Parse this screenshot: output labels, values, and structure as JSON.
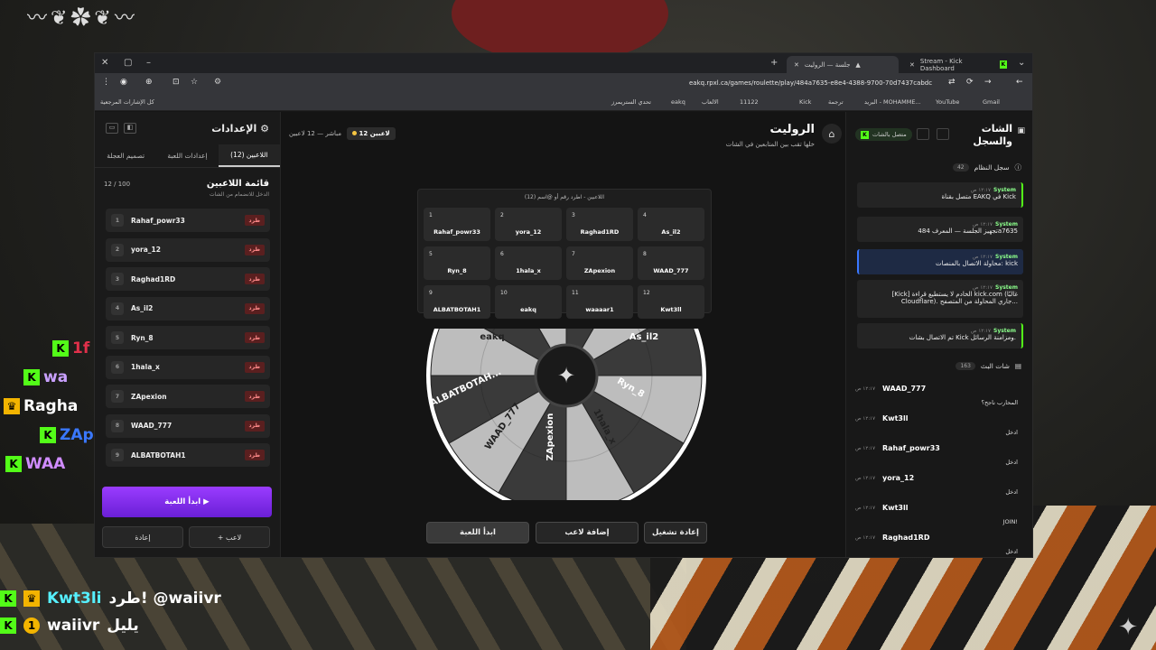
{
  "browser": {
    "tabs": [
      {
        "label": "جلسة — الروليت"
      },
      {
        "label": "Stream - Kick Dashboard"
      }
    ],
    "url": "eakq.rpxl.ca/games/roulette/play/484a7635-e8e4-4388-9700-70d7437cabdc",
    "bookmarks": [
      "Gmail",
      "YouTube",
      "البريد - MOHAMME...",
      "ترجمة",
      "Kick",
      "11122",
      "الالعاب",
      "eakq",
      "تحدي الستريمرز",
      "كل الإشارات المرجعية"
    ]
  },
  "settings": {
    "title": "الإعدادات",
    "tabs": [
      "اللاعبين (12)",
      "إعدادات اللعبة",
      "تصميم العجلة"
    ],
    "players_title": "قائمة اللاعبين",
    "players_sub": "الدخل للانضمام من الشات",
    "count": "12 / 100",
    "kick_label": "طرد",
    "players": [
      {
        "n": "1",
        "name": "Rahaf_powr33"
      },
      {
        "n": "2",
        "name": "yora_12"
      },
      {
        "n": "3",
        "name": "Raghad1RD"
      },
      {
        "n": "4",
        "name": "As_il2"
      },
      {
        "n": "5",
        "name": "Ryn_8"
      },
      {
        "n": "6",
        "name": "1hala_x"
      },
      {
        "n": "7",
        "name": "ZApexion"
      },
      {
        "n": "8",
        "name": "WAAD_777"
      },
      {
        "n": "9",
        "name": "ALBATBOTAH1"
      }
    ],
    "start_label": "ابدأ اللعبة ▶",
    "reset_label": "إعادة",
    "add_label": "+ لاعب"
  },
  "center": {
    "title": "الروليت",
    "subtitle": "خلها تقب بين المتابعين في الشات",
    "live_count": "12 لاعبين",
    "live_text": "مباشر — 12 لاعبين",
    "grid_caption": "اللاعبين - اطرد رقم أو @اسم (12)",
    "grid": [
      {
        "n": "1",
        "name": "Rahaf_powr33"
      },
      {
        "n": "2",
        "name": "yora_12"
      },
      {
        "n": "3",
        "name": "Raghad1RD"
      },
      {
        "n": "4",
        "name": "As_il2"
      },
      {
        "n": "5",
        "name": "Ryn_8"
      },
      {
        "n": "6",
        "name": "1hala_x"
      },
      {
        "n": "7",
        "name": "ZApexion"
      },
      {
        "n": "8",
        "name": "WAAD_777"
      },
      {
        "n": "9",
        "name": "ALBATBOTAH1"
      },
      {
        "n": "10",
        "name": "eakq"
      },
      {
        "n": "11",
        "name": "waaaar1"
      },
      {
        "n": "12",
        "name": "Kwt3ll"
      }
    ],
    "wheel_labels": [
      "eakq",
      "As_il2",
      "ALBATBOTAH...",
      "Ryn_8",
      "WAAD_777",
      "1hala_x",
      "ZApexion"
    ],
    "btn_start": "ابدأ اللعبة",
    "btn_add": "إضافة لاعب",
    "btn_restart": "إعادة تشغيل"
  },
  "chat": {
    "title": "الشات والسجل",
    "connected": "متصل بالشات",
    "system_log_title": "سجل النظام",
    "system_log_count": "42",
    "system_messages": [
      {
        "who": "System",
        "time": "١٢:١٧ ص",
        "text": "متصل بقناة EAKQ في Kick"
      },
      {
        "who": "System",
        "time": "١٢:١٧ ص",
        "text": "تجهيز الجلسة — المعرف 484a7635"
      },
      {
        "who": "System",
        "time": "١٢:١٧ ص",
        "text": "محاولة الاتصال بالمنصات: kick"
      },
      {
        "who": "System",
        "time": "١٢:١٧ ص",
        "text": "[Kick] الخادم لا يستطيع قراءة kick.com (غالبًا Cloudflare). جاري المحاولة من المتصفح..."
      },
      {
        "who": "System",
        "time": "١٢:١٧ ص",
        "text": "تم الاتصال بشات Kick ومزامنة الرسائل."
      }
    ],
    "live_chat_title": "شات البث",
    "live_chat_count": "163",
    "messages": [
      {
        "user": "WAAD_777",
        "time": "١٢:١٧ ص",
        "text": "المحارب ناجح؟"
      },
      {
        "user": "Kwt3ll",
        "time": "١٢:١٧ ص",
        "text": "ادخل"
      },
      {
        "user": "Rahaf_powr33",
        "time": "١٢:١٧ ص",
        "text": "ادخل"
      },
      {
        "user": "yora_12",
        "time": "١٢:١٧ ص",
        "text": "ادخل"
      },
      {
        "user": "Kwt3ll",
        "time": "١٢:١٧ ص",
        "text": "JOIN!"
      },
      {
        "user": "Raghad1RD",
        "time": "١٢:١٧ ص",
        "text": "ادخل"
      }
    ]
  },
  "overlay": {
    "side_names": [
      "1f",
      "wa",
      "Ragha",
      "ZAp",
      "WAA"
    ],
    "bottom_rows": [
      {
        "user": "Kwt3li",
        "text": "طرد! @waiivr"
      },
      {
        "user": "waiivr",
        "text": "يليل"
      }
    ]
  },
  "colors": {
    "accent": "#7b2cf5",
    "kick_green": "#53fc18",
    "kick_red": "#5a1f1f"
  }
}
